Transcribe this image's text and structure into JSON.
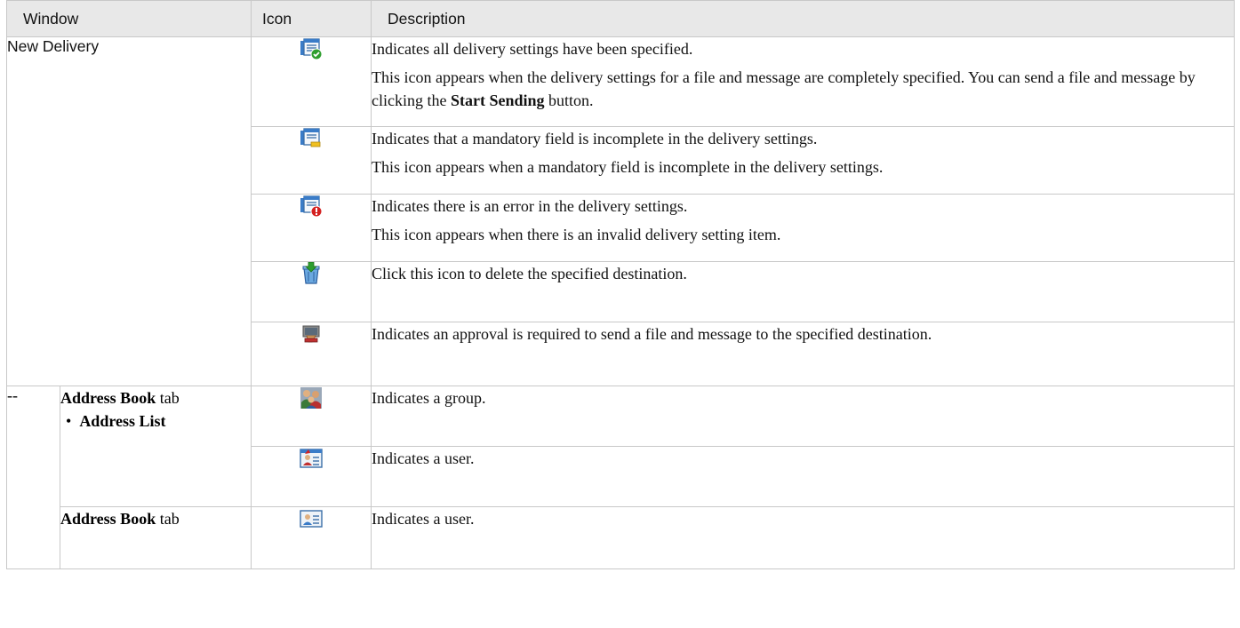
{
  "headers": {
    "window": "Window",
    "icon": "Icon",
    "description": "Description"
  },
  "new_delivery": "New Delivery",
  "dash": "--",
  "address_book_tab": {
    "bold": "Address Book",
    "suffix": " tab"
  },
  "address_list": {
    "bullet": "•",
    "label": "Address List"
  },
  "rows": [
    {
      "icon": "delivery-complete-icon",
      "line1": "Indicates all delivery settings have been specified.",
      "line2_pre": "This icon appears when the delivery settings for a file and message are completely specified. You can send a file and message by clicking the ",
      "line2_bold": "Start Sending",
      "line2_post": " button."
    },
    {
      "icon": "delivery-incomplete-icon",
      "line1": "Indicates that a mandatory field is incomplete in the delivery settings.",
      "line2": "This icon appears when a mandatory field is incomplete in the delivery settings."
    },
    {
      "icon": "delivery-error-icon",
      "line1": "Indicates there is an error in the delivery settings.",
      "line2": "This icon appears when there is an invalid delivery setting item."
    },
    {
      "icon": "delete-destination-icon",
      "line1": "Click this icon to delete the specified destination."
    },
    {
      "icon": "approval-required-icon",
      "line1": "Indicates an approval is required to send a file and message to the specified destination."
    },
    {
      "icon": "group-icon",
      "line1": "Indicates a group."
    },
    {
      "icon": "user-card-icon",
      "line1": "Indicates a user."
    },
    {
      "icon": "user-card-blue-icon",
      "line1": "Indicates a user."
    }
  ],
  "colors": {
    "header_bg": "#e8e8e8",
    "border": "#c8c8c8",
    "ok_green": "#2e9e2e",
    "error_red": "#d42020",
    "warn_yellow": "#f0c020"
  }
}
